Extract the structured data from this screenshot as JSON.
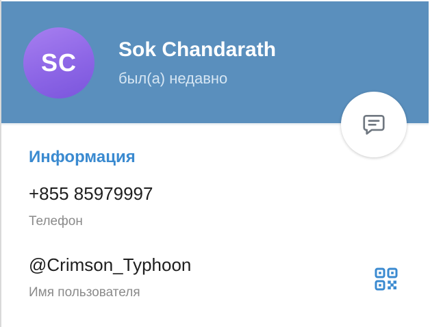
{
  "profile": {
    "initials": "SC",
    "name": "Sok Chandarath",
    "status": "был(а) недавно",
    "avatar_colors": [
      "#a77ff0",
      "#7a55dc"
    ],
    "header_color": "#5a8fbd"
  },
  "info": {
    "section_title": "Информация",
    "phone_value": "+855 85979997",
    "phone_label": "Телефон",
    "username_value": "@Crimson_Typhoon",
    "username_label": "Имя пользователя",
    "accent_color": "#3a8ad0"
  },
  "icons": {
    "message": "message-icon",
    "qr": "qr-code-icon"
  }
}
